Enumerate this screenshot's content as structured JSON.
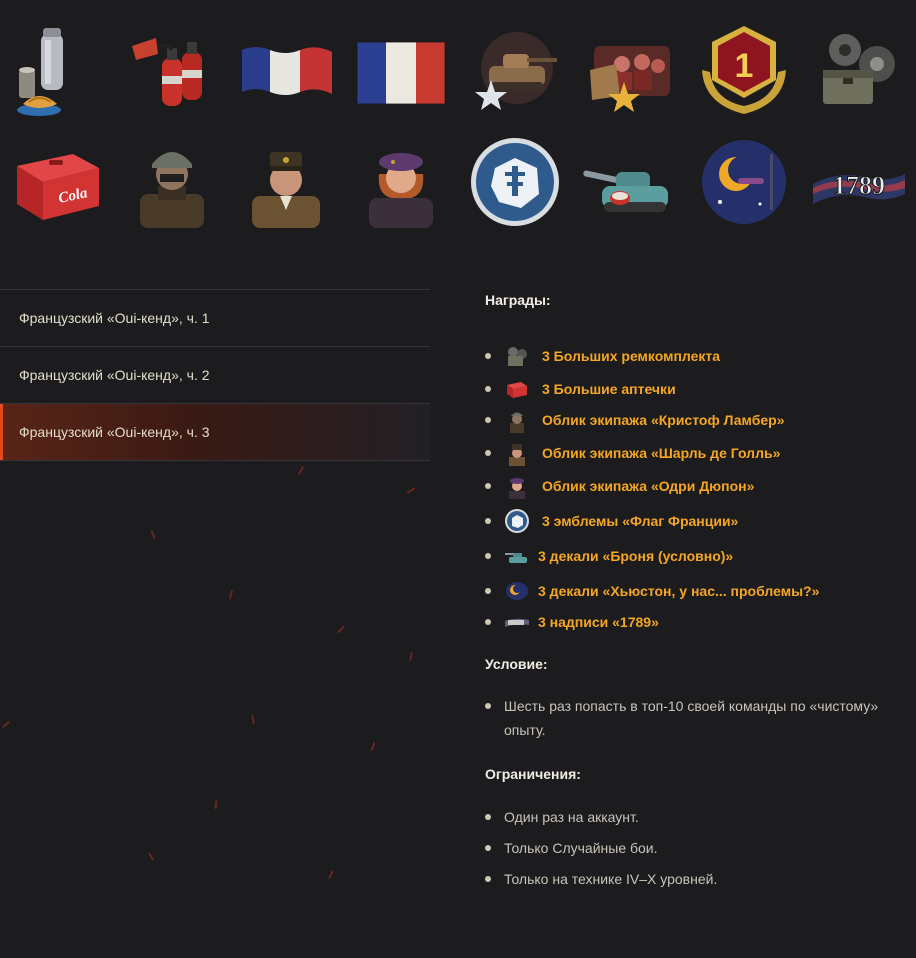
{
  "top_icons": [
    [
      "thermos-rations-icon",
      "fire-extinguisher-icon",
      "french-flag-waving-icon",
      "french-flag-icon",
      "tank-star-icon",
      "crew-star-icon",
      "first-place-medal-icon",
      "repair-kit-icon"
    ],
    [
      "cola-first-aid-kit-icon",
      "helmet-soldier-portrait-icon",
      "de-gaulle-portrait-icon",
      "beret-woman-portrait-icon",
      "free-france-emblem-icon",
      "armor-tank-decal-icon",
      "houston-moon-decal-icon",
      "inscription-1789-icon"
    ]
  ],
  "top_icon_texts": {
    "medal_number": "1",
    "cola": "Cola",
    "inscription": "1789"
  },
  "missions": [
    {
      "label": "Французский «Oui-кенд», ч. 1",
      "active": false
    },
    {
      "label": "Французский «Oui-кенд», ч. 2",
      "active": false
    },
    {
      "label": "Французский «Oui-кенд», ч. 3",
      "active": true
    }
  ],
  "details": {
    "rewards_title": "Награды:",
    "rewards": [
      {
        "icon": "repair-kit-icon",
        "label": "3 Больших ремкомплекта"
      },
      {
        "icon": "first-aid-kit-icon",
        "label": "3 Большие аптечки"
      },
      {
        "icon": "crew-lambert-icon",
        "label": "Облик экипажа «Кристоф Ламбер»"
      },
      {
        "icon": "crew-de-gaulle-icon",
        "label": "Облик экипажа «Шарль де Голль»"
      },
      {
        "icon": "crew-odri-icon",
        "label": "Облик экипажа «Одри Дюпон»"
      },
      {
        "icon": "emblem-flag-icon",
        "label": "3 эмблемы «Флаг Франции»"
      },
      {
        "icon": "armor-decal-icon",
        "label": "3 декали «Броня (условно)»"
      },
      {
        "icon": "houston-decal-icon",
        "label": "3 декали «Хьюстон, у нас... проблемы?»"
      },
      {
        "icon": "inscription-1789-icon",
        "label": "3 надписи «1789»"
      }
    ],
    "condition_title": "Условие:",
    "conditions": [
      "Шесть раз попасть в топ-10 своей команды по «чистому» опыту."
    ],
    "restrictions_title": "Ограничения:",
    "restrictions": [
      "Один раз на аккаунт.",
      "Только Случайные бои.",
      "Только на технике IV–X уровней."
    ]
  },
  "colors": {
    "background": "#1c1c1f",
    "accent_orange": "#f5a623",
    "active_marker": "#e24a1e",
    "divider": "#34343a"
  }
}
